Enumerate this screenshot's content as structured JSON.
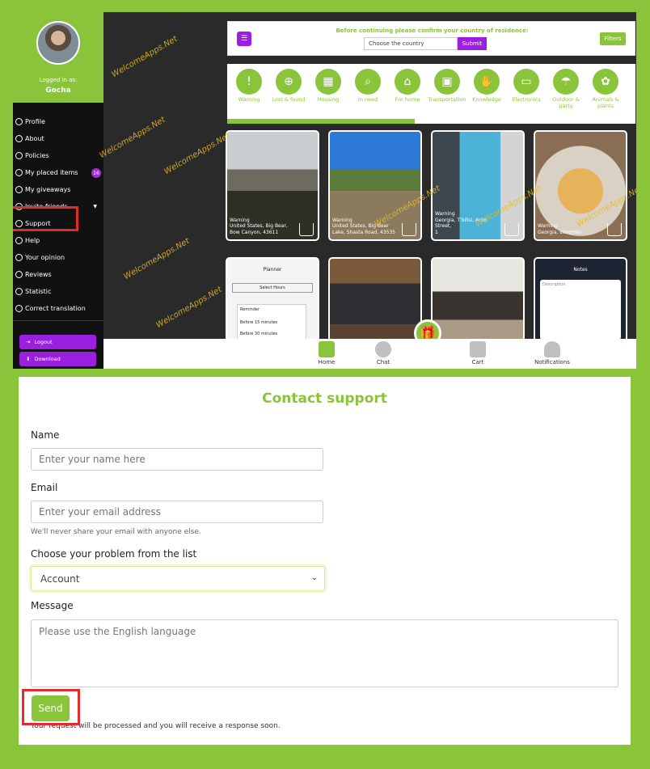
{
  "top": {
    "logged_in_label": "Logged in as:",
    "username": "Gocha",
    "menu": [
      {
        "label": "Profile"
      },
      {
        "label": "About"
      },
      {
        "label": "Policies"
      },
      {
        "label": "My placed items",
        "badge": "16"
      },
      {
        "label": "My giveaways"
      },
      {
        "label": "Invite friends"
      },
      {
        "label": "Support"
      },
      {
        "label": "Help"
      },
      {
        "label": "Your opinion"
      },
      {
        "label": "Reviews"
      },
      {
        "label": "Statistic"
      },
      {
        "label": "Correct translation"
      }
    ],
    "logout_label": "Logout",
    "download_label": "Download",
    "notice": "Before continuing please confirm your country of residence:",
    "country_placeholder": "Choose the country",
    "submit_label": "Submit",
    "filters_label": "Filters",
    "categories": [
      {
        "label": "Warning",
        "icon": "warning-icon"
      },
      {
        "label": "Lost & found",
        "icon": "help-icon"
      },
      {
        "label": "Housing",
        "icon": "housing-icon"
      },
      {
        "label": "In need",
        "icon": "search-icon"
      },
      {
        "label": "For home",
        "icon": "home-icon"
      },
      {
        "label": "Transportation",
        "icon": "car-icon"
      },
      {
        "label": "Knowledge",
        "icon": "handshake-icon"
      },
      {
        "label": "Electronics",
        "icon": "monitor-icon"
      },
      {
        "label": "Outdoor & party",
        "icon": "umbrella-icon"
      },
      {
        "label": "Animals & plants",
        "icon": "paw-icon"
      }
    ],
    "category_progress": 0.46,
    "cards": [
      {
        "line1": "Warning",
        "line2": "United States, Big Bear,",
        "line3": "Bow Canyon, 43611"
      },
      {
        "line1": "Warning",
        "line2": "United States, Big Bear",
        "line3": "Lake, Shasta Road, 43535"
      },
      {
        "line1": "Warning",
        "line2": "Georgia, T'bilisi, Arbo Street,",
        "line3": "1"
      },
      {
        "line1": "Warning",
        "line2": "Georgia, თბილისი",
        "line3": ""
      }
    ],
    "phone_card": {
      "title": "Planner",
      "select": "Select Hours",
      "reminder": "Reminder",
      "opt1": "Before 15 minutes",
      "opt2": "Before 30 minutes"
    },
    "notes_card": {
      "title": "Notes",
      "placeholder": "Description"
    },
    "watermark": "WelcomeApps.Net",
    "nav": [
      {
        "label": "Home"
      },
      {
        "label": "Chat"
      },
      {
        "label": "Cart"
      },
      {
        "label": "Notifications"
      }
    ]
  },
  "form": {
    "title": "Contact support",
    "name_label": "Name",
    "name_placeholder": "Enter your name here",
    "email_label": "Email",
    "email_placeholder": "Enter your email address",
    "email_hint": "We'll never share your email with anyone else.",
    "problem_label": "Choose your problem from the list",
    "problem_value": "Account",
    "message_label": "Message",
    "message_placeholder": "Please use the English language",
    "send_label": "Send",
    "note": "Your request will be processed and you will receive a response soon."
  },
  "colors": {
    "brand_green": "#8ac43a",
    "brand_purple": "#9b1fe0",
    "highlight_red": "#e22b2b"
  }
}
